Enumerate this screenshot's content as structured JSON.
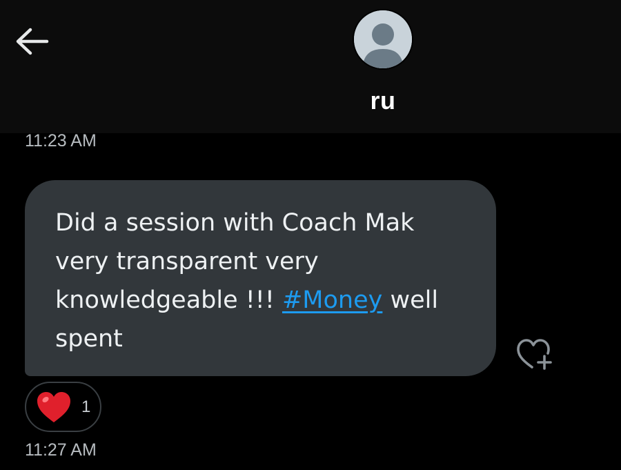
{
  "header": {
    "back_icon": "arrow-left-icon",
    "contact_name": "ru",
    "avatar_icon": "default-avatar-icon"
  },
  "messages": [
    {
      "timestamp": "11:23 AM",
      "text_before": "Did a session with Coach Mak very transparent very knowledgeable !!! ",
      "hashtag": "#Money",
      "text_after": " well spent",
      "add_reaction_icon": "heart-plus-icon",
      "reaction": {
        "emoji_icon": "red-heart-icon",
        "count": "1"
      }
    }
  ],
  "footer_timestamp": "11:27 AM",
  "colors": {
    "background": "#000000",
    "bubble": "#32373b",
    "link": "#1d9bf0",
    "heart": "#e0202c"
  }
}
